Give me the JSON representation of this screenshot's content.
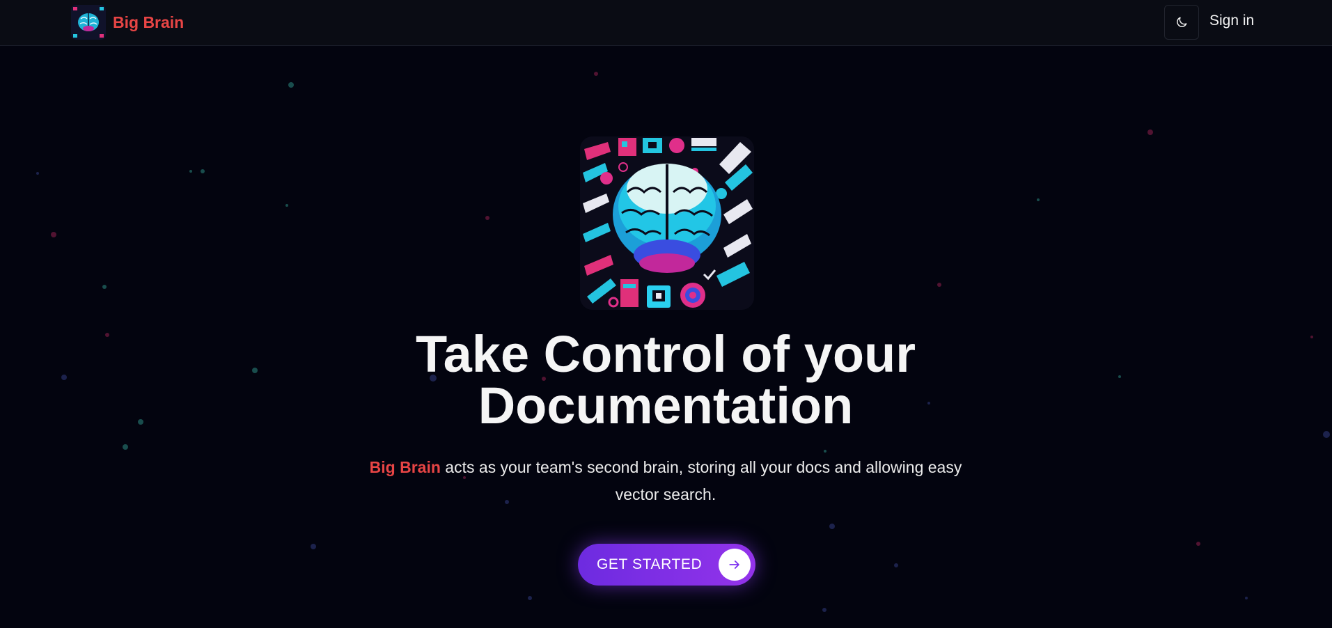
{
  "header": {
    "brand_name": "Big Brain",
    "logo_icon": "brain-logo-icon",
    "theme_toggle_icon": "moon-icon",
    "signin_label": "Sign in"
  },
  "hero": {
    "image_icon": "brain-illustration",
    "headline_line1": "Take Control of your",
    "headline_line2": "Documentation",
    "subtext_brand": "Big Brain",
    "subtext_rest_line1": " acts as your team's second brain, storing all your docs and allowing easy",
    "subtext_rest_line2": "vector search.",
    "cta_label": "GET STARTED",
    "cta_icon": "arrow-right-icon"
  },
  "colors": {
    "background": "#03040f",
    "header_bg": "#0a0c14",
    "brand_accent": "#e84545",
    "cta_gradient_start": "#6d2be0",
    "cta_gradient_end": "#9333ea",
    "text": "#f5f5f5"
  }
}
